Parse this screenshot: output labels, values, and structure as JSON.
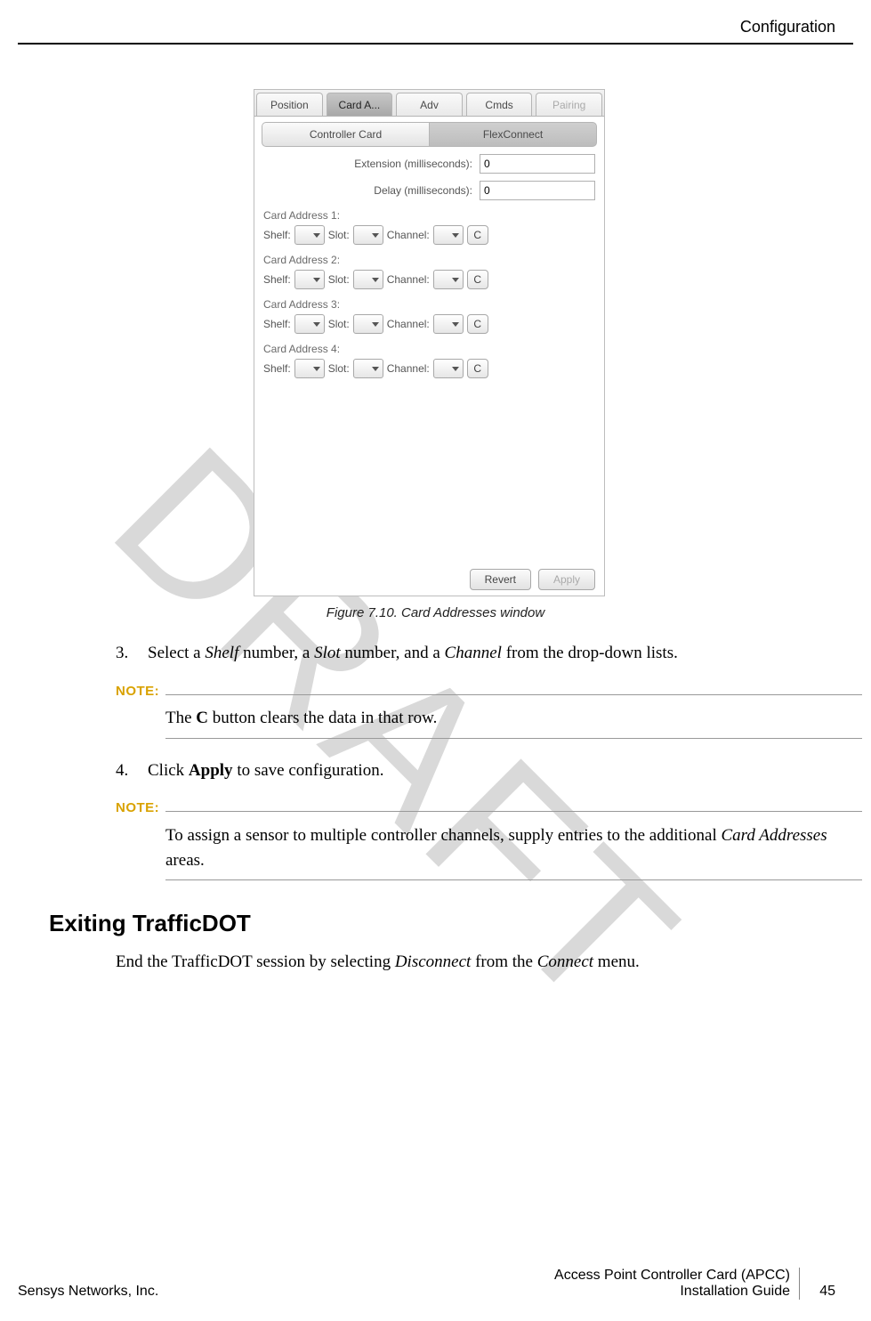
{
  "header": {
    "section": "Configuration"
  },
  "watermark": "DRAFT",
  "ui": {
    "tabs": {
      "position": "Position",
      "card_a": "Card A...",
      "adv": "Adv",
      "cmds": "Cmds",
      "pairing": "Pairing"
    },
    "subtabs": {
      "controller": "Controller Card",
      "flex": "FlexConnect"
    },
    "ext_label": "Extension (milliseconds):",
    "delay_label": "Delay (milliseconds):",
    "ext_value": "0",
    "delay_value": "0",
    "addr_titles": [
      "Card Address 1:",
      "Card Address 2:",
      "Card Address 3:",
      "Card Address 4:"
    ],
    "shelf": "Shelf:",
    "slot": "Slot:",
    "channel": "Channel:",
    "c": "C",
    "revert": "Revert",
    "apply": "Apply"
  },
  "figure_caption": "Figure 7.10. Card Addresses window",
  "steps": {
    "s3_num": "3.",
    "s3_a": "Select a ",
    "s3_shelf": "Shelf",
    "s3_b": " number, a ",
    "s3_slot": "Slot",
    "s3_c": " number, and a ",
    "s3_channel": "Channel",
    "s3_d": " from the drop-down lists.",
    "s4_num": "4.",
    "s4_a": "Click ",
    "s4_apply": "Apply",
    "s4_b": " to save configuration."
  },
  "notes": {
    "label": "NOTE:",
    "n1_a": "The ",
    "n1_c": "C",
    "n1_b": " button clears the data in that row.",
    "n2_a": "To assign a sensor to multiple controller channels, supply entries to the additional ",
    "n2_i": "Card Addresses",
    "n2_b": " areas."
  },
  "section": {
    "heading": "Exiting TrafficDOT",
    "p_a": "End the TrafficDOT session by selecting ",
    "p_disconnect": "Disconnect",
    "p_b": " from the ",
    "p_connect": "Connect",
    "p_c": " menu."
  },
  "footer": {
    "left": "Sensys Networks, Inc.",
    "right1": "Access Point Controller Card (APCC)",
    "right2": "Installation Guide",
    "page": "45"
  }
}
